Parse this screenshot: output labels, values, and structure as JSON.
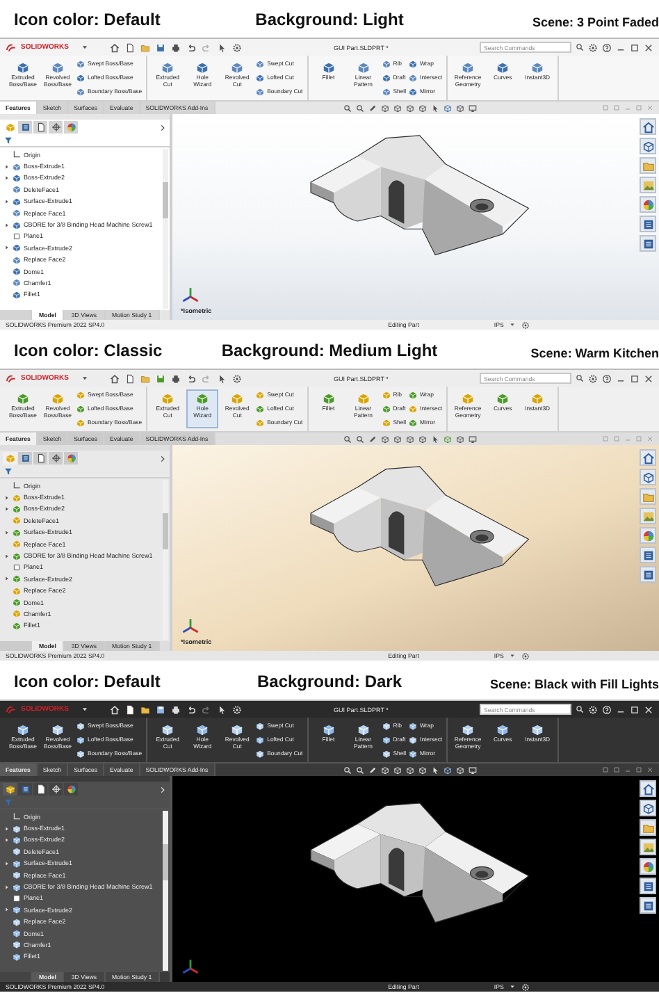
{
  "panels": [
    {
      "caption": {
        "icon_color": "Icon color: Default",
        "background": "Background: Light",
        "scene": "Scene: 3 Point Faded"
      },
      "icon_set": {
        "kind": "default"
      },
      "viewport": {
        "kind": "faded",
        "view_label": "*Isometric"
      },
      "window": {
        "kind": "light",
        "app": "SOLIDWORKS",
        "title": "GUI Part.SLDPRT *",
        "search": {
          "placeholder": "Search Commands"
        }
      },
      "ribbon": [
        {
          "large": [
            {
              "label": "Extruded Boss/Base",
              "highlighted": false
            },
            {
              "label": "Revolved Boss/Base",
              "highlighted": false
            }
          ],
          "small": [
            [
              "Swept Boss/Base",
              "Lofted Boss/Base",
              "Boundary Boss/Base"
            ]
          ]
        },
        {
          "large": [
            {
              "label": "Extruded Cut",
              "highlighted": false
            },
            {
              "label": "Hole Wizard",
              "highlighted": false
            },
            {
              "label": "Revolved Cut",
              "highlighted": false
            }
          ],
          "small": [
            [
              "Swept Cut",
              "Lofted Cut",
              "Boundary Cut"
            ]
          ]
        },
        {
          "large": [
            {
              "label": "Fillet",
              "highlighted": false
            },
            {
              "label": "Linear Pattern",
              "highlighted": false
            }
          ],
          "small": [
            [
              "Rib",
              "Draft",
              "Shell"
            ],
            [
              "Wrap",
              "Intersect",
              "Mirror"
            ]
          ]
        },
        {
          "large": [
            {
              "label": "Reference Geometry",
              "highlighted": false
            },
            {
              "label": "Curves",
              "highlighted": false
            },
            {
              "label": "Instant3D",
              "highlighted": false
            }
          ]
        }
      ],
      "tabs": [
        {
          "label": "Features",
          "selected": true
        },
        {
          "label": "Sketch",
          "selected": false
        },
        {
          "label": "Surfaces",
          "selected": false
        },
        {
          "label": "Evaluate",
          "selected": false
        },
        {
          "label": "SOLIDWORKS Add-Ins",
          "selected": false
        }
      ],
      "tree": [
        {
          "label": "Origin",
          "kind": "origin",
          "expandable": false
        },
        {
          "label": "Boss-Extrude1",
          "kind": "feature",
          "expandable": true
        },
        {
          "label": "Boss-Extrude2",
          "kind": "feature",
          "expandable": true
        },
        {
          "label": "DeleteFace1",
          "kind": "feature",
          "expandable": false
        },
        {
          "label": "Surface-Extrude1",
          "kind": "feature",
          "expandable": true
        },
        {
          "label": "Replace Face1",
          "kind": "feature",
          "expandable": false
        },
        {
          "label": "CBORE for 3/8 Binding Head Machine Screw1",
          "kind": "feature",
          "expandable": true
        },
        {
          "label": "Plane1",
          "kind": "plane",
          "expandable": false
        },
        {
          "label": "Surface-Extrude2",
          "kind": "feature",
          "expandable": true
        },
        {
          "label": "Replace Face2",
          "kind": "feature",
          "expandable": false
        },
        {
          "label": "Dome1",
          "kind": "feature",
          "expandable": false
        },
        {
          "label": "Chamfer1",
          "kind": "feature",
          "expandable": false
        },
        {
          "label": "Fillet1",
          "kind": "feature",
          "expandable": false
        }
      ],
      "bottom_tabs": [
        {
          "label": "Model",
          "selected": true
        },
        {
          "label": "3D Views",
          "selected": false
        },
        {
          "label": "Motion Study 1",
          "selected": false
        }
      ],
      "status": {
        "product": "SOLIDWORKS Premium 2022 SP4.0",
        "mode": "Editing Part",
        "units": "IPS"
      }
    },
    {
      "caption": {
        "icon_color": "Icon color: Classic",
        "background": "Background: Medium Light",
        "scene": "Scene: Warm Kitchen"
      },
      "icon_set": {
        "kind": "classic"
      },
      "viewport": {
        "kind": "warm",
        "view_label": "*Isometric"
      },
      "window": {
        "kind": "medium",
        "app": "SOLIDWORKS",
        "title": "GUI Part.SLDPRT *",
        "search": {
          "placeholder": "Search Commands"
        }
      },
      "ribbon": [
        {
          "large": [
            {
              "label": "Extruded Boss/Base",
              "highlighted": false
            },
            {
              "label": "Revolved Boss/Base",
              "highlighted": false
            }
          ],
          "small": [
            [
              "Swept Boss/Base",
              "Lofted Boss/Base",
              "Boundary Boss/Base"
            ]
          ]
        },
        {
          "large": [
            {
              "label": "Extruded Cut",
              "highlighted": false
            },
            {
              "label": "Hole Wizard",
              "highlighted": true
            },
            {
              "label": "Revolved Cut",
              "highlighted": false
            }
          ],
          "small": [
            [
              "Swept Cut",
              "Lofted Cut",
              "Boundary Cut"
            ]
          ]
        },
        {
          "large": [
            {
              "label": "Fillet",
              "highlighted": false
            },
            {
              "label": "Linear Pattern",
              "highlighted": false
            }
          ],
          "small": [
            [
              "Rib",
              "Draft",
              "Shell"
            ],
            [
              "Wrap",
              "Intersect",
              "Mirror"
            ]
          ]
        },
        {
          "large": [
            {
              "label": "Reference Geometry",
              "highlighted": false
            },
            {
              "label": "Curves",
              "highlighted": false
            },
            {
              "label": "Instant3D",
              "highlighted": false
            }
          ]
        }
      ],
      "tabs": [
        {
          "label": "Features",
          "selected": true
        },
        {
          "label": "Sketch",
          "selected": false
        },
        {
          "label": "Surfaces",
          "selected": false
        },
        {
          "label": "Evaluate",
          "selected": false
        },
        {
          "label": "SOLIDWORKS Add-Ins",
          "selected": false
        }
      ],
      "tree": [
        {
          "label": "Origin",
          "kind": "origin",
          "expandable": false
        },
        {
          "label": "Boss-Extrude1",
          "kind": "feature",
          "expandable": true
        },
        {
          "label": "Boss-Extrude2",
          "kind": "feature",
          "expandable": true
        },
        {
          "label": "DeleteFace1",
          "kind": "feature",
          "expandable": false
        },
        {
          "label": "Surface-Extrude1",
          "kind": "feature",
          "expandable": true
        },
        {
          "label": "Replace Face1",
          "kind": "feature",
          "expandable": false
        },
        {
          "label": "CBORE for 3/8 Binding Head Machine Screw1",
          "kind": "feature",
          "expandable": true
        },
        {
          "label": "Plane1",
          "kind": "plane",
          "expandable": false
        },
        {
          "label": "Surface-Extrude2",
          "kind": "feature",
          "expandable": true
        },
        {
          "label": "Replace Face2",
          "kind": "feature",
          "expandable": false
        },
        {
          "label": "Dome1",
          "kind": "feature",
          "expandable": false
        },
        {
          "label": "Chamfer1",
          "kind": "feature",
          "expandable": false
        },
        {
          "label": "Fillet1",
          "kind": "feature",
          "expandable": false
        }
      ],
      "bottom_tabs": [
        {
          "label": "Model",
          "selected": true
        },
        {
          "label": "3D Views",
          "selected": false
        },
        {
          "label": "Motion Study 1",
          "selected": false
        }
      ],
      "status": {
        "product": "SOLIDWORKS Premium 2022 SP4.0",
        "mode": "Editing Part",
        "units": "IPS"
      }
    },
    {
      "caption": {
        "icon_color": "Icon color: Default",
        "background": "Background: Dark",
        "scene": "Scene: Black with Fill Lights"
      },
      "icon_set": {
        "kind": "default"
      },
      "viewport": {
        "kind": "black"
      },
      "window": {
        "kind": "dark",
        "app": "SOLIDWORKS",
        "title": "GUI Part.SLDPRT *",
        "search": {
          "placeholder": "Search Commands"
        }
      },
      "ribbon": [
        {
          "large": [
            {
              "label": "Extruded Boss/Base",
              "highlighted": false
            },
            {
              "label": "Revolved Boss/Base",
              "highlighted": false
            }
          ],
          "small": [
            [
              "Swept Boss/Base",
              "Lofted Boss/Base",
              "Boundary Boss/Base"
            ]
          ]
        },
        {
          "large": [
            {
              "label": "Extruded Cut",
              "highlighted": false
            },
            {
              "label": "Hole Wizard",
              "highlighted": false
            },
            {
              "label": "Revolved Cut",
              "highlighted": false
            }
          ],
          "small": [
            [
              "Swept Cut",
              "Lofted Cut",
              "Boundary Cut"
            ]
          ]
        },
        {
          "large": [
            {
              "label": "Fillet",
              "highlighted": false
            },
            {
              "label": "Linear Pattern",
              "highlighted": false
            }
          ],
          "small": [
            [
              "Rib",
              "Draft",
              "Shell"
            ],
            [
              "Wrap",
              "Intersect",
              "Mirror"
            ]
          ]
        },
        {
          "large": [
            {
              "label": "Reference Geometry",
              "highlighted": false
            },
            {
              "label": "Curves",
              "highlighted": false
            },
            {
              "label": "Instant3D",
              "highlighted": false
            }
          ]
        }
      ],
      "tabs": [
        {
          "label": "Features",
          "selected": true
        },
        {
          "label": "Sketch",
          "selected": false
        },
        {
          "label": "Surfaces",
          "selected": false
        },
        {
          "label": "Evaluate",
          "selected": false
        },
        {
          "label": "SOLIDWORKS Add-Ins",
          "selected": false
        }
      ],
      "tree": [
        {
          "label": "Origin",
          "kind": "origin",
          "expandable": false
        },
        {
          "label": "Boss-Extrude1",
          "kind": "feature",
          "expandable": true
        },
        {
          "label": "Boss-Extrude2",
          "kind": "feature",
          "expandable": true
        },
        {
          "label": "DeleteFace1",
          "kind": "feature",
          "expandable": false
        },
        {
          "label": "Surface-Extrude1",
          "kind": "feature",
          "expandable": true
        },
        {
          "label": "Replace Face1",
          "kind": "feature",
          "expandable": false
        },
        {
          "label": "CBORE for 3/8 Binding Head Machine Screw1",
          "kind": "feature",
          "expandable": true
        },
        {
          "label": "Plane1",
          "kind": "plane",
          "expandable": false
        },
        {
          "label": "Surface-Extrude2",
          "kind": "feature",
          "expandable": true
        },
        {
          "label": "Replace Face2",
          "kind": "feature",
          "expandable": false
        },
        {
          "label": "Dome1",
          "kind": "feature",
          "expandable": false
        },
        {
          "label": "Chamfer1",
          "kind": "feature",
          "expandable": false
        },
        {
          "label": "Fillet1",
          "kind": "feature",
          "expandable": false
        }
      ],
      "bottom_tabs": [
        {
          "label": "Model",
          "selected": true
        },
        {
          "label": "3D Views",
          "selected": false
        },
        {
          "label": "Motion Study 1",
          "selected": false
        }
      ],
      "status": {
        "product": "SOLIDWORKS Premium 2022 SP4.0",
        "mode": "Editing Part",
        "units": "IPS"
      }
    }
  ]
}
